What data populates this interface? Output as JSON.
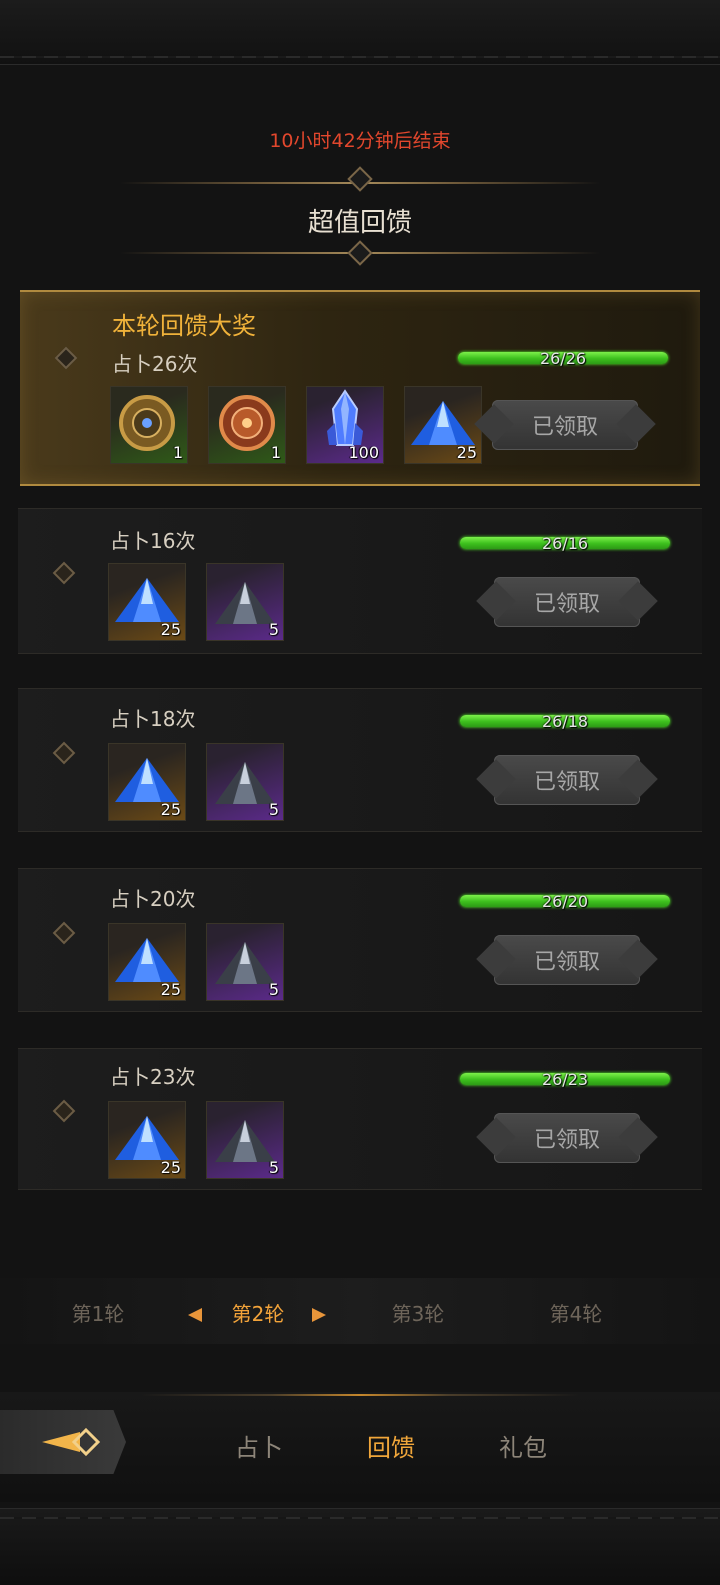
{
  "header": {
    "countdown": "10小时42分钟后结束",
    "title": "超值回馈"
  },
  "grand_prize": {
    "title": "本轮回馈大奖",
    "label": "占卜26次",
    "progress_text": "26/26",
    "progress": 1.0,
    "items": [
      {
        "icon": "bronze-disc-icon",
        "count": "1",
        "rarity": "green"
      },
      {
        "icon": "copper-disc-icon",
        "count": "1",
        "rarity": "green"
      },
      {
        "icon": "blue-crystal-icon",
        "count": "100",
        "rarity": "purple"
      },
      {
        "icon": "blue-crystal-pile-icon",
        "count": "25",
        "rarity": "orange"
      }
    ],
    "button": "已领取"
  },
  "rewards": [
    {
      "label": "占卜16次",
      "progress_text": "26/16",
      "progress": 1.0,
      "items": [
        {
          "icon": "blue-crystal-pile-icon",
          "count": "25",
          "rarity": "orange"
        },
        {
          "icon": "dark-crystal-pile-icon",
          "count": "5",
          "rarity": "purple"
        }
      ],
      "button": "已领取"
    },
    {
      "label": "占卜18次",
      "progress_text": "26/18",
      "progress": 1.0,
      "items": [
        {
          "icon": "blue-crystal-pile-icon",
          "count": "25",
          "rarity": "orange"
        },
        {
          "icon": "dark-crystal-pile-icon",
          "count": "5",
          "rarity": "purple"
        }
      ],
      "button": "已领取"
    },
    {
      "label": "占卜20次",
      "progress_text": "26/20",
      "progress": 1.0,
      "items": [
        {
          "icon": "blue-crystal-pile-icon",
          "count": "25",
          "rarity": "orange"
        },
        {
          "icon": "dark-crystal-pile-icon",
          "count": "5",
          "rarity": "purple"
        }
      ],
      "button": "已领取"
    },
    {
      "label": "占卜23次",
      "progress_text": "26/23",
      "progress": 1.0,
      "items": [
        {
          "icon": "blue-crystal-pile-icon",
          "count": "25",
          "rarity": "orange"
        },
        {
          "icon": "dark-crystal-pile-icon",
          "count": "5",
          "rarity": "purple"
        }
      ],
      "button": "已领取"
    }
  ],
  "rounds": {
    "tabs": [
      "第1轮",
      "第2轮",
      "第3轮",
      "第4轮"
    ],
    "active": "第2轮"
  },
  "bottom_nav": {
    "tabs": [
      "占卜",
      "回馈",
      "礼包"
    ],
    "active": "回馈",
    "back_icon": "back-arrow-icon"
  },
  "colors": {
    "accent": "#f0a63a",
    "countdown": "#e2472d",
    "progress": "#3cbf1d",
    "grand_title": "#f0b23a"
  }
}
